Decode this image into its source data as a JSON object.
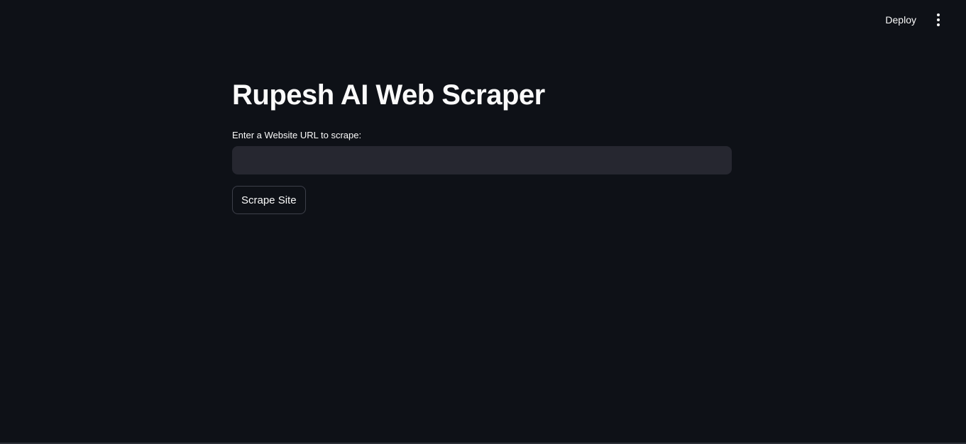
{
  "header": {
    "deploy_label": "Deploy",
    "menu_icon": "vertical-ellipsis-icon"
  },
  "main": {
    "title": "Rupesh AI Web Scraper",
    "url_field": {
      "label": "Enter a Website URL to scrape:",
      "value": "",
      "placeholder": ""
    },
    "scrape_button_label": "Scrape Site"
  },
  "colors": {
    "background": "#0e1117",
    "input_background": "#262730",
    "text": "#fafafa",
    "button_border": "#3d404a"
  }
}
